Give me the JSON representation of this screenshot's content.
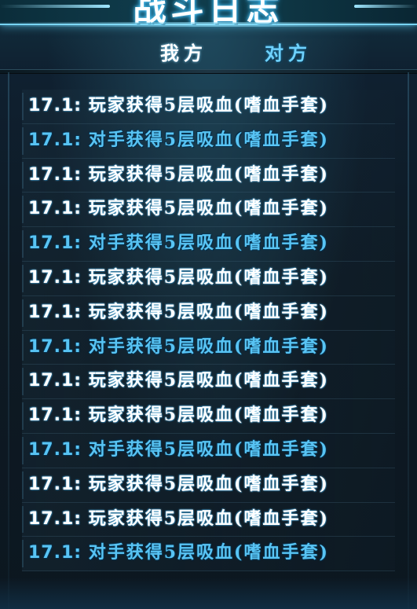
{
  "header": {
    "title": "战斗日志"
  },
  "tabs": [
    {
      "label": "我方",
      "selected": true
    },
    {
      "label": "对方",
      "selected": false
    }
  ],
  "log": [
    {
      "time": "17.1:",
      "message": "玩家获得5层吸血(嗜血手套)",
      "side": "player"
    },
    {
      "time": "17.1:",
      "message": "对手获得5层吸血(嗜血手套)",
      "side": "opponent"
    },
    {
      "time": "17.1:",
      "message": "玩家获得5层吸血(嗜血手套)",
      "side": "player"
    },
    {
      "time": "17.1:",
      "message": "玩家获得5层吸血(嗜血手套)",
      "side": "player"
    },
    {
      "time": "17.1:",
      "message": "对手获得5层吸血(嗜血手套)",
      "side": "opponent"
    },
    {
      "time": "17.1:",
      "message": "玩家获得5层吸血(嗜血手套)",
      "side": "player"
    },
    {
      "time": "17.1:",
      "message": "玩家获得5层吸血(嗜血手套)",
      "side": "player"
    },
    {
      "time": "17.1:",
      "message": "对手获得5层吸血(嗜血手套)",
      "side": "opponent"
    },
    {
      "time": "17.1:",
      "message": "玩家获得5层吸血(嗜血手套)",
      "side": "player"
    },
    {
      "time": "17.1:",
      "message": "玩家获得5层吸血(嗜血手套)",
      "side": "player"
    },
    {
      "time": "17.1:",
      "message": "对手获得5层吸血(嗜血手套)",
      "side": "opponent"
    },
    {
      "time": "17.1:",
      "message": "玩家获得5层吸血(嗜血手套)",
      "side": "player"
    },
    {
      "time": "17.1:",
      "message": "玩家获得5层吸血(嗜血手套)",
      "side": "player"
    },
    {
      "time": "17.1:",
      "message": "对手获得5层吸血(嗜血手套)",
      "side": "opponent"
    }
  ],
  "colors": {
    "player_text": "#ffffff",
    "opponent_text": "#58c4f4",
    "background": "#0e1a24",
    "accent_glow": "#7bd6f4"
  }
}
